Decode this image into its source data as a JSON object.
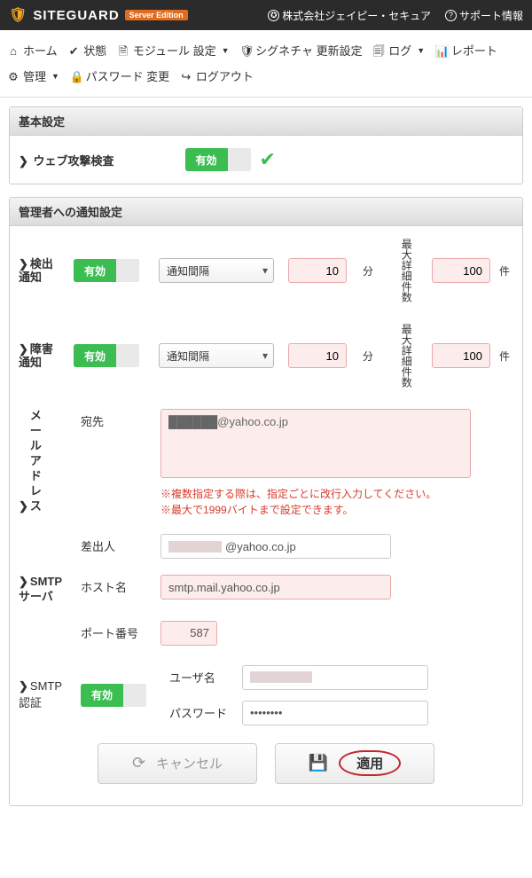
{
  "brand": {
    "name": "SITEGUARD",
    "badge": "Server Edition"
  },
  "toplinks": {
    "company": "株式会社ジェイピー・セキュア",
    "support": "サポート情報"
  },
  "nav": {
    "home": "ホーム",
    "status": "状態",
    "module": "モジュール 設定",
    "signature": "シグネチャ 更新設定",
    "log": "ログ",
    "report": "レポート",
    "admin": "管理",
    "password": "パスワード 変更",
    "logout": "ログアウト"
  },
  "panels": {
    "basic": {
      "title": "基本設定",
      "web_attack_label": "ウェブ攻撃検査",
      "toggle_on": "有効"
    },
    "notify": {
      "title": "管理者への通知設定",
      "rows": {
        "detect": {
          "label": "検出\n通知",
          "interval_placeholder": "通知間隔",
          "minutes": "10",
          "min_unit": "分",
          "max_label": "最大詳細件数",
          "max": "100",
          "max_unit": "件",
          "toggle_on": "有効"
        },
        "failure": {
          "label": "障害\n通知",
          "interval_placeholder": "通知間隔",
          "minutes": "10",
          "min_unit": "分",
          "max_label": "最大詳細件数",
          "max": "100",
          "max_unit": "件",
          "toggle_on": "有効"
        }
      },
      "mail": {
        "section_label": "メールアドレス",
        "to_label": "宛先",
        "to_value": "@yahoo.co.jp",
        "note1": "※複数指定する際は、指定ごとに改行入力してください。",
        "note2": "※最大で1999バイトまで設定できます。",
        "from_label": "差出人",
        "from_value": "@yahoo.co.jp"
      },
      "smtp": {
        "section_label": "SMTP\nサーバ",
        "host_label": "ホスト名",
        "host_value": "smtp.mail.yahoo.co.jp",
        "port_label": "ポート番号",
        "port_value": "587"
      },
      "auth": {
        "section_label": "SMTP\n認証",
        "toggle_on": "有効",
        "user_label": "ユーザ名",
        "user_value": "",
        "pass_label": "パスワード",
        "pass_value": "••••••••"
      }
    }
  },
  "buttons": {
    "cancel": "キャンセル",
    "apply": "適用"
  }
}
